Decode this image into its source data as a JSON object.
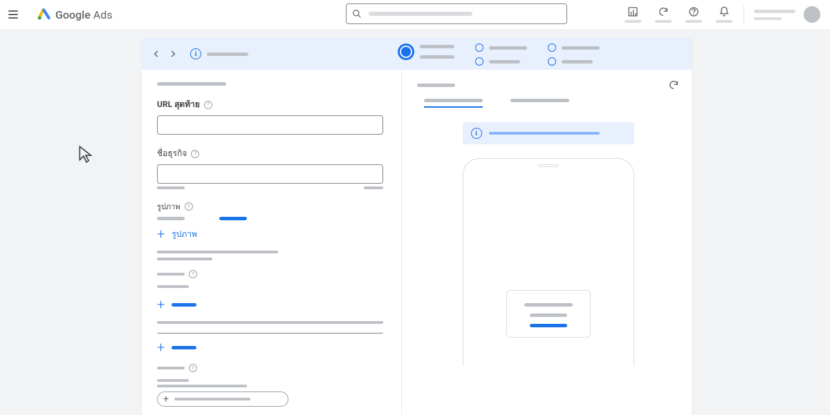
{
  "header": {
    "product_name_prefix": "Google",
    "product_name_suffix": "Ads"
  },
  "form": {
    "url_label": "URL สุดท้าย",
    "business_name_label": "ชื่อธุรกิจ",
    "images_label": "รูปภาพ",
    "add_images_label": "รูปภาพ"
  }
}
